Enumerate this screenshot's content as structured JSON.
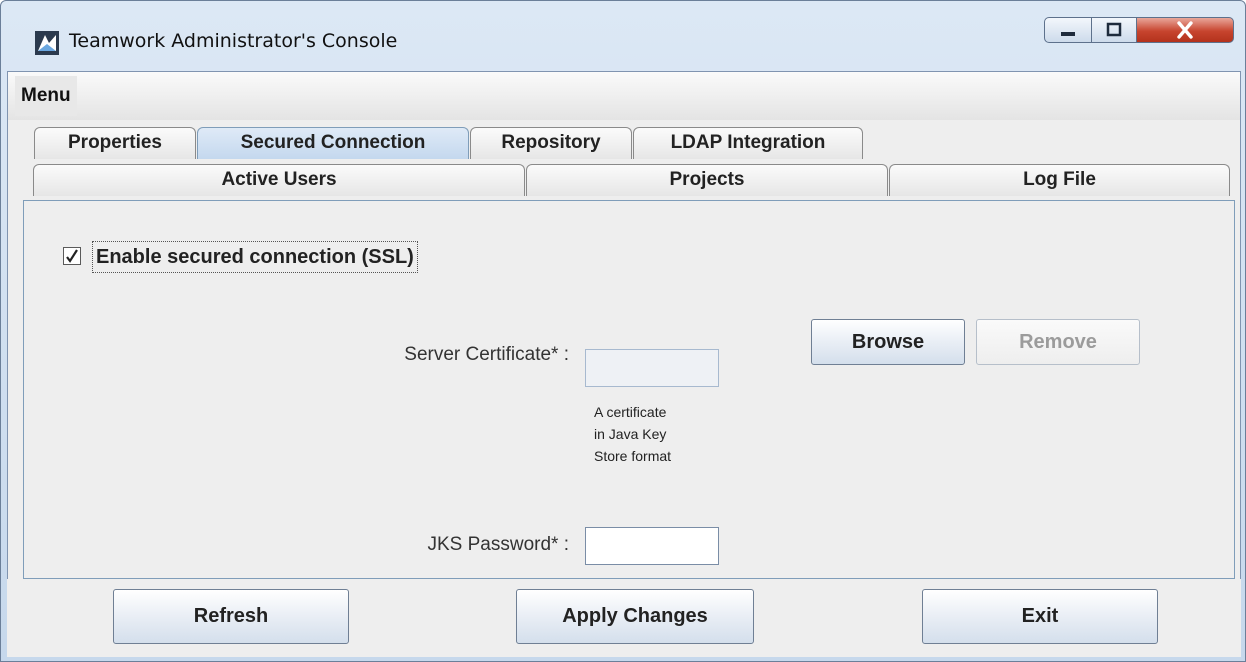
{
  "window": {
    "title": "Teamwork Administrator's Console",
    "controls": {
      "minimize": "minimize-icon",
      "maximize": "maximize-icon",
      "close": "close-icon"
    }
  },
  "menu": {
    "label": "Menu"
  },
  "tabs": {
    "row1": [
      "Properties",
      "Secured Connection",
      "Repository",
      "LDAP Integration"
    ],
    "row2": [
      "Active Users",
      "Projects",
      "Log File"
    ],
    "selected": "Secured Connection"
  },
  "ssl": {
    "enable_label": "Enable secured connection (SSL)",
    "enabled": true,
    "certificate_label": "Server Certificate* :",
    "certificate_value": "",
    "certificate_hint": [
      "A certificate",
      "in Java Key",
      "Store format"
    ],
    "password_label": "JKS Password* :",
    "password_value": "",
    "browse_label": "Browse",
    "remove_label": "Remove"
  },
  "footer": {
    "refresh_label": "Refresh",
    "apply_label": "Apply Changes",
    "exit_label": "Exit"
  }
}
